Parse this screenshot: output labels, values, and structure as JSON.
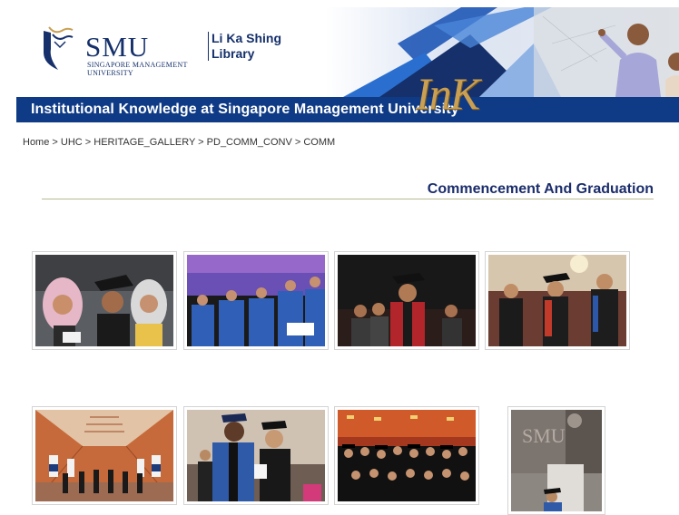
{
  "header": {
    "smu_wordmark": "SMU",
    "smu_subtitle_line1": "SINGAPORE MANAGEMENT",
    "smu_subtitle_line2": "UNIVERSITY",
    "library_line1": "Li Ka Shing",
    "library_line2": "Library",
    "bar_title": "Institutional Knowledge at Singapore Management University",
    "ink_logo": "InK",
    "colors": {
      "brand_navy": "#0f3b86",
      "ink_gold": "#c99f53"
    }
  },
  "breadcrumb": {
    "text": "Home > UHC > HERITAGE_GALLERY > PD_COMM_CONV > COMM"
  },
  "page": {
    "title": "Commencement And Graduation"
  },
  "gallery": {
    "items": [
      {
        "subject": "graduates-in-hijab"
      },
      {
        "subject": "faculty-seated-in-gowns"
      },
      {
        "subject": "speaker-on-stage-red-gown"
      },
      {
        "subject": "faculty-procession"
      },
      {
        "subject": "procession-hall-flags"
      },
      {
        "subject": "graduate-with-professor"
      },
      {
        "subject": "graduates-crowd-caps"
      },
      {
        "subject": "podium-smu-backdrop"
      }
    ]
  }
}
